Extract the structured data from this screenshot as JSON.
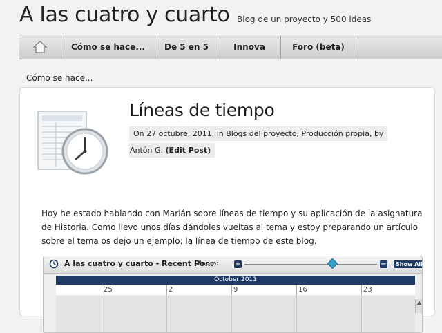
{
  "site": {
    "title": "A las cuatro y cuarto",
    "tagline": "Blog de un proyecto y 500 ideas"
  },
  "nav": {
    "home_icon": "home-icon",
    "items": [
      {
        "label": "Cómo se hace..."
      },
      {
        "label": "De 5 en 5"
      },
      {
        "label": "Innova"
      },
      {
        "label": "Foro (beta)"
      }
    ]
  },
  "breadcrumb": "Cómo se hace...",
  "post": {
    "icon": "timeline-clock-icon",
    "title": "Líneas de tiempo",
    "meta_line1": "On 27 octubre, 2011, in Blogs del proyecto, Producción propia, by",
    "meta_author": "Antón G.",
    "meta_edit": "(Edit Post)",
    "body": "Hoy he estado hablando con Marián sobre líneas de tiempo y su aplicación de la asignatura de Historia. Como llevo unos días dándoles vueltas al tema y estoy preparando un artículo sobre el tema os dejo un ejemplo: la línea de tiempo de este blog."
  },
  "timeline": {
    "title": "A las cuatro y cuarto - Recent Po...",
    "zoom_label": "Zoom:",
    "plus_label": "+",
    "minus_label": "−",
    "show_all_label": "Show All",
    "month": "October 2011",
    "days": [
      "25",
      "2",
      "9",
      "16",
      "23"
    ]
  },
  "colors": {
    "nav_bg": "#d8d8d8",
    "timeline_accent": "#1f3b66",
    "slider_handle": "#3aa0c8"
  }
}
